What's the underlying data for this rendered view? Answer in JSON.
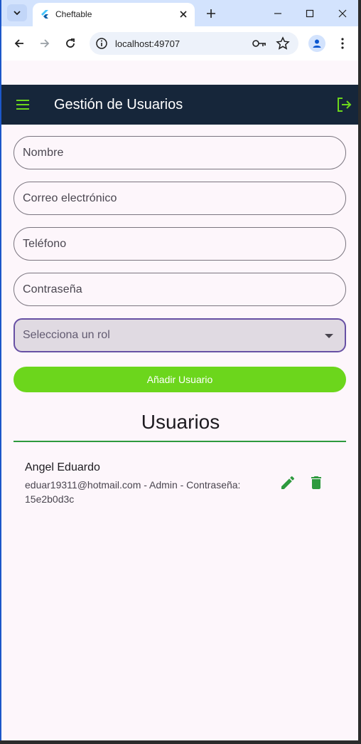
{
  "browser": {
    "tab_title": "Cheftable",
    "url": "localhost:49707"
  },
  "app": {
    "title": "Gestión de Usuarios",
    "accent_color": "#6cd61c",
    "appbar_color": "#16263a"
  },
  "form": {
    "name_label": "Nombre",
    "email_label": "Correo electrónico",
    "phone_label": "Teléfono",
    "password_label": "Contraseña",
    "role_placeholder": "Selecciona un rol",
    "add_button_label": "Añadir Usuario"
  },
  "users_section": {
    "title": "Usuarios",
    "users": [
      {
        "name": "Angel Eduardo",
        "details": "eduar19311@hotmail.com - Admin - Contraseña: 15e2b0d3c"
      }
    ]
  },
  "icons": {
    "menu": "hamburger-icon",
    "logout": "logout-icon",
    "edit": "pencil-icon",
    "delete": "trash-icon"
  }
}
